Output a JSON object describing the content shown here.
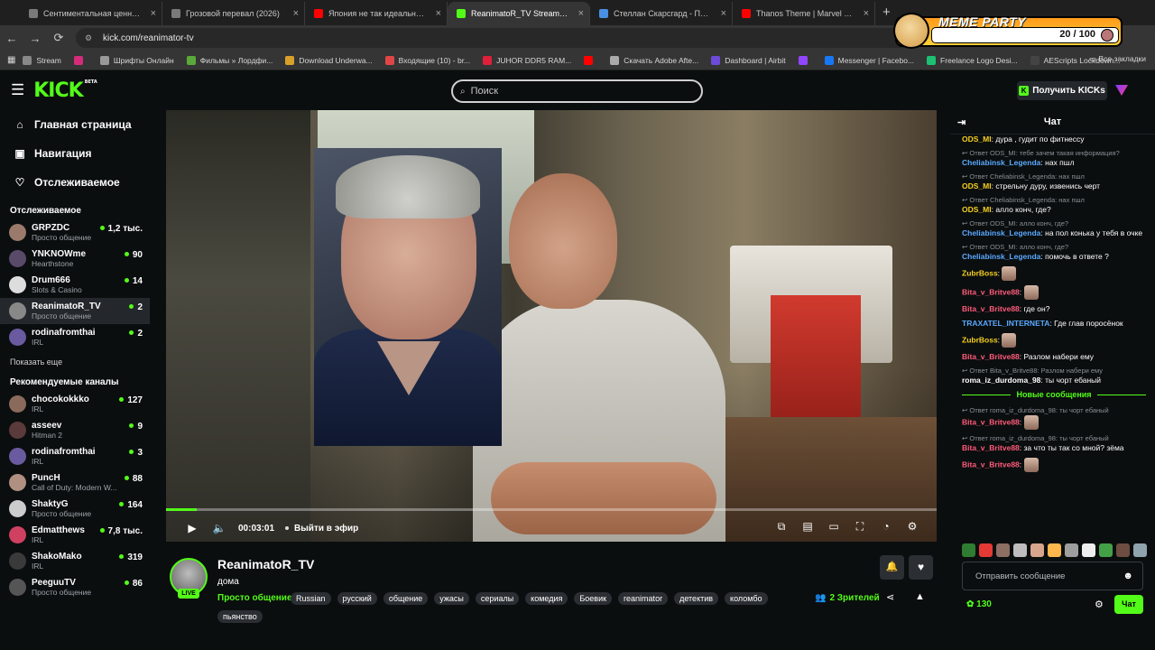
{
  "browser": {
    "tabs": [
      {
        "title": "Сентиментальная ценность (2",
        "color": "#7a7a7a"
      },
      {
        "title": "Грозовой перевал (2026)",
        "color": "#7a7a7a"
      },
      {
        "title": "Япония не так идеальна, как т",
        "color": "#ff0000"
      },
      {
        "title": "ReanimatoR_TV Stream - Watch",
        "color": "#53fc18",
        "active": true
      },
      {
        "title": "Стеллан Скарсгард - Поиск в",
        "color": "#4a90e2"
      },
      {
        "title": "Thanos Theme | Marvel Cine",
        "color": "#ff0000"
      }
    ],
    "url": "kick.com/reanimator-tv",
    "bookmarks": [
      {
        "label": "Stream",
        "color": "#888"
      },
      {
        "label": "",
        "color": "#d42b7a"
      },
      {
        "label": "Шрифты Онлайн",
        "color": "#999"
      },
      {
        "label": "Фильмы » Лордфи...",
        "color": "#5ba83a"
      },
      {
        "label": "Download Underwa...",
        "color": "#d8a02a"
      },
      {
        "label": "Входящие (10) - br...",
        "color": "#e04646"
      },
      {
        "label": "JUHOR DDR5 RAM...",
        "color": "#e0203a"
      },
      {
        "label": "",
        "color": "#ff0000"
      },
      {
        "label": "Скачать Adobe Afte...",
        "color": "#aaa"
      },
      {
        "label": "Dashboard | Airbit",
        "color": "#6b4bd8"
      },
      {
        "label": "",
        "color": "#9146ff"
      },
      {
        "label": "Messenger | Facebo...",
        "color": "#1877f2"
      },
      {
        "label": "Freelance Logo Desi...",
        "color": "#1dbf73"
      },
      {
        "label": "AEScripts Lockdown...",
        "color": "#444"
      }
    ],
    "all_bookmarks": "Все закладки",
    "extension": {
      "title": "MEME PARTY",
      "score": "20 / 100"
    }
  },
  "kick": {
    "logo": "KICK",
    "logo_beta": "BETA",
    "search_placeholder": "Поиск",
    "get_kicks": "Получить KICKs",
    "nav": [
      {
        "label": "Главная страница",
        "icon": "home-icon",
        "glyph": "⌂"
      },
      {
        "label": "Навигация",
        "icon": "browse-icon",
        "glyph": "▣"
      },
      {
        "label": "Отслеживаемое",
        "icon": "heart-icon",
        "glyph": "♡"
      }
    ],
    "following_header": "Отслеживаемое",
    "following": [
      {
        "name": "GRPZDC",
        "game": "Просто общение",
        "viewers": "1,2 тыс.",
        "color": "#9a7a6a"
      },
      {
        "name": "YNKNOWme",
        "game": "Hearthstone",
        "viewers": "90",
        "color": "#5a4a6a"
      },
      {
        "name": "Drum666",
        "game": "Slots & Casino",
        "viewers": "14",
        "color": "#dddddd"
      },
      {
        "name": "ReanimatoR_TV",
        "game": "Просто общение",
        "viewers": "2",
        "color": "#888888",
        "active": true
      },
      {
        "name": "rodinafromthai",
        "game": "IRL",
        "viewers": "2",
        "color": "#6a5aa0"
      }
    ],
    "show_more": "Показать еще",
    "recommended_header": "Рекомендуемые каналы",
    "recommended": [
      {
        "name": "chocokokkko",
        "game": "IRL",
        "viewers": "127",
        "color": "#8a6a5a"
      },
      {
        "name": "asseev",
        "game": "Hitman 2",
        "viewers": "9",
        "color": "#5a3a3a"
      },
      {
        "name": "rodinafromthai",
        "game": "IRL",
        "viewers": "3",
        "color": "#6a5aa0"
      },
      {
        "name": "PuncH",
        "game": "Call of Duty: Modern W...",
        "viewers": "88",
        "color": "#b09080"
      },
      {
        "name": "ShaktyG",
        "game": "Просто общение",
        "viewers": "164",
        "color": "#cccccc"
      },
      {
        "name": "Edmatthews",
        "game": "IRL",
        "viewers": "7,8 тыс.",
        "color": "#d04060"
      },
      {
        "name": "ShakoMako",
        "game": "IRL",
        "viewers": "319",
        "color": "#3a3a3a"
      },
      {
        "name": "PeeguuTV",
        "game": "Просто общение",
        "viewers": "86",
        "color": "#555555"
      }
    ],
    "player": {
      "time": "00:03:01",
      "go_live": "Выйти в эфир",
      "progress": 0.04
    },
    "stream": {
      "name": "ReanimatoR_TV",
      "title": "дома",
      "category": "Просто общение",
      "live": "LIVE",
      "tags": [
        "Russian",
        "русский",
        "общение",
        "ужасы",
        "сериалы",
        "комедия",
        "Боевик",
        "reanimator",
        "детектив",
        "коломбо"
      ],
      "tag_overflow": "пьянство",
      "viewers": "2 Зрителей"
    },
    "chat": {
      "title": "Чат",
      "new_messages": "Новые сообщения",
      "input_placeholder": "Отправить сообщение",
      "kicks": "130",
      "send": "Чат",
      "messages": [
        {
          "user": "ODS_MI",
          "ucolor": "#f5d020",
          "text": "дура , гудит по фитнессу"
        },
        {
          "reply": "Ответ ODS_MI: тебе зачем такая информация?",
          "user": "Cheliabinsk_Legenda",
          "ucolor": "#5aa9ff",
          "text": "нах пшл"
        },
        {
          "reply": "Ответ Cheliabinsk_Legenda: нах пшл",
          "user": "ODS_MI",
          "ucolor": "#f5d020",
          "text": "стрельну дуру, извенись черт"
        },
        {
          "reply": "Ответ Cheliabinsk_Legenda: нах пшл",
          "user": "ODS_MI",
          "ucolor": "#f5d020",
          "text": "алло конч, где?"
        },
        {
          "reply": "Ответ ODS_MI: алло конч, где?",
          "user": "Cheliabinsk_Legenda",
          "ucolor": "#5aa9ff",
          "text": "на пол конька у тебя в очке"
        },
        {
          "reply": "Ответ ODS_MI: алло конч, где?",
          "user": "Cheliabinsk_Legenda",
          "ucolor": "#5aa9ff",
          "text": "помочь в ответе ?"
        },
        {
          "user": "ZubrBoss",
          "ucolor": "#f5d020",
          "text": "",
          "emote": true
        },
        {
          "user": "Bita_v_Britve88",
          "ucolor": "#ff5a7a",
          "text": "",
          "emote": true
        },
        {
          "user": "Bita_v_Britve88",
          "ucolor": "#ff5a7a",
          "text": "где он?"
        },
        {
          "user": "TRAXATEL_INTERNETA",
          "ucolor": "#5aa9ff",
          "text": "Где глав поросёнок"
        },
        {
          "user": "ZubrBoss",
          "ucolor": "#f5d020",
          "text": "",
          "emote": true
        },
        {
          "user": "Bita_v_Britve88",
          "ucolor": "#ff5a7a",
          "text": "Разлом набери ему"
        },
        {
          "reply": "Ответ Bita_v_Britve88: Разлом набери ему",
          "user": "roma_iz_durdoma_98",
          "ucolor": "#ffffff",
          "text": "ты чорт ебаный"
        }
      ],
      "messages_after": [
        {
          "reply": "Ответ roma_iz_durdoma_98: ты чорт ебаный",
          "user": "Bita_v_Britve88",
          "ucolor": "#ff5a7a",
          "text": "",
          "emote": true
        },
        {
          "reply": "Ответ roma_iz_durdoma_98: ты чорт ебаный",
          "user": "Bita_v_Britve88",
          "ucolor": "#ff5a7a",
          "text": "за что ты так со мной? зёма"
        },
        {
          "user": "Bita_v_Britve88",
          "ucolor": "#ff5a7a",
          "text": "",
          "emote": true
        }
      ]
    }
  }
}
